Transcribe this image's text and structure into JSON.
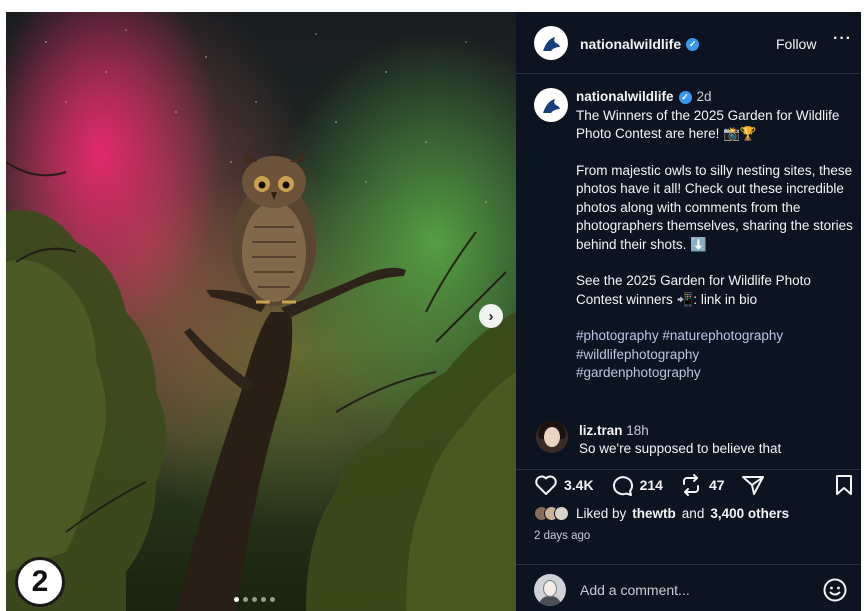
{
  "step_badge": "2",
  "photo": {
    "alt_icons": {
      "next": "chevron-right-icon"
    },
    "carousel_dots": [
      true,
      false,
      false,
      false,
      false
    ]
  },
  "header": {
    "username": "nationalwildlife",
    "follow_label": "Follow",
    "more_label": "···"
  },
  "caption": {
    "username": "nationalwildlife",
    "time": "2d",
    "paragraphs": [
      "The Winners of the 2025 Garden for Wildlife Photo Contest are here! 📸🏆",
      "From majestic owls to silly nesting sites, these photos have it all! Check out these incredible photos along with comments from the photographers themselves, sharing the stories behind their shots. ⬇️",
      "See the 2025 Garden for Wildlife Photo Contest winners 📲: link in bio"
    ],
    "hashtags": "#photography #naturephotography\n#wildlifephotography\n#gardenphotography"
  },
  "comment": {
    "username": "liz.tran",
    "time": "18h",
    "text": "So we're supposed to believe that"
  },
  "actions": {
    "likes": "3.4K",
    "comments": "214",
    "reposts": "47"
  },
  "liked_by": {
    "prefix": "Liked by",
    "user": "thewtb",
    "joiner": "and",
    "others": "3,400 others"
  },
  "posted_ago": "2 days ago",
  "add_comment": {
    "placeholder": "Add a comment..."
  },
  "colors": {
    "panel_bg": "#0c1422",
    "verified": "#3897f0",
    "text": "#f4f4f6"
  }
}
